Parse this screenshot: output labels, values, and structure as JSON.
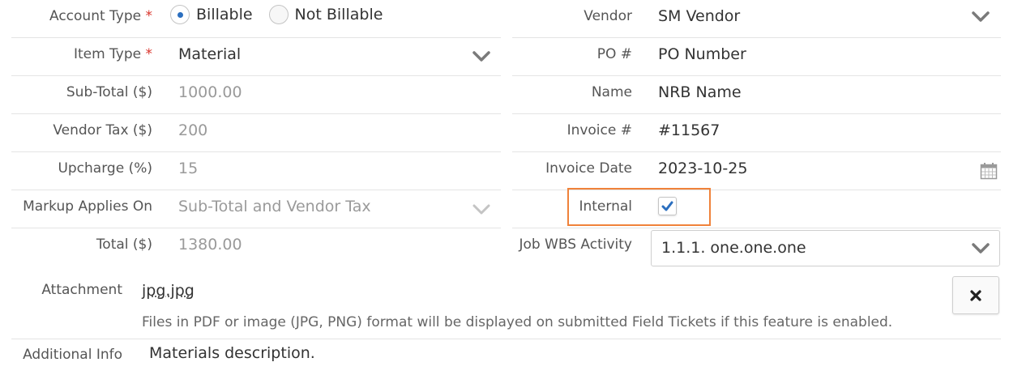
{
  "left": {
    "account_type": {
      "label": "Account Type",
      "required_mark": "*",
      "options": [
        "Billable",
        "Not Billable"
      ],
      "selected": "Billable"
    },
    "item_type": {
      "label": "Item Type",
      "required_mark": "*",
      "value": "Material"
    },
    "sub_total": {
      "label": "Sub-Total ($)",
      "value": "1000.00"
    },
    "vendor_tax": {
      "label": "Vendor Tax ($)",
      "value": "200"
    },
    "upcharge": {
      "label": "Upcharge (%)",
      "value": "15"
    },
    "markup_applies_on": {
      "label": "Markup Applies On",
      "value": "Sub-Total and Vendor Tax"
    },
    "total": {
      "label": "Total ($)",
      "value": "1380.00"
    }
  },
  "right": {
    "vendor": {
      "label": "Vendor",
      "value": "SM Vendor"
    },
    "po_number": {
      "label": "PO #",
      "value": "PO Number"
    },
    "name": {
      "label": "Name",
      "value": "NRB Name"
    },
    "invoice_number": {
      "label": "Invoice #",
      "value": "#11567"
    },
    "invoice_date": {
      "label": "Invoice Date",
      "value": "2023-10-25"
    },
    "internal": {
      "label": "Internal",
      "checked": true
    },
    "job_wbs_activity": {
      "label": "Job WBS Activity",
      "value": "1.1.1. one.one.one"
    }
  },
  "attachment": {
    "label": "Attachment",
    "file_name": "jpg.jpg",
    "note": "Files in PDF or image (JPG, PNG) format will be displayed on submitted Field Tickets if this feature is enabled."
  },
  "additional_info": {
    "label": "Additional Info",
    "value": "Materials description."
  },
  "icons": [
    "chevron-down-icon",
    "calendar-icon",
    "checkmark-icon",
    "close-icon"
  ],
  "colors": {
    "accent": "#2b6fbf",
    "required": "#d9342b",
    "highlight": "#f0823a",
    "muted_text": "#9a9a9a"
  }
}
